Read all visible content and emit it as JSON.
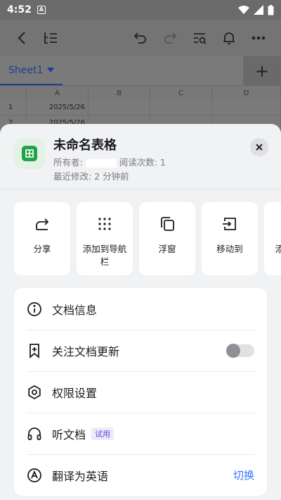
{
  "status_bar": {
    "time": "4:52",
    "app_badge": "A"
  },
  "toolbar": {
    "icons": [
      "back-icon",
      "outline-icon",
      "undo-icon",
      "redo-icon",
      "search-doc-icon",
      "bell-icon",
      "more-icon"
    ]
  },
  "sheet_tabs": {
    "active_tab": "Sheet1",
    "add_label": "+"
  },
  "grid": {
    "columns": [
      "A",
      "B",
      "C",
      "D"
    ],
    "rows": [
      {
        "num": "1",
        "a": "2025/5/26"
      },
      {
        "num": "2",
        "a": "2025/5/26"
      }
    ]
  },
  "doc": {
    "title": "未命名表格",
    "owner_label": "所有者:",
    "read_count_label": "阅读次数: 1",
    "last_modified": "最近修改: 2 分钟前"
  },
  "actions": [
    {
      "label": "分享",
      "icon": "share-icon"
    },
    {
      "label": "添加到导航栏",
      "icon": "grid-dots-icon"
    },
    {
      "label": "浮窗",
      "icon": "float-window-icon"
    },
    {
      "label": "移动到",
      "icon": "move-to-icon"
    },
    {
      "label": "添",
      "icon": "partial-icon"
    }
  ],
  "menu": [
    {
      "label": "文档信息",
      "icon": "info-icon"
    },
    {
      "label": "关注文档更新",
      "icon": "bookmark-plus-icon",
      "toggle_on": false
    },
    {
      "label": "权限设置",
      "icon": "gear-icon"
    },
    {
      "label": "听文档",
      "icon": "headphones-icon",
      "badge": "试用"
    },
    {
      "label": "翻译为英语",
      "icon": "translate-icon",
      "action": "切换"
    }
  ],
  "colors": {
    "accent": "#3370ff",
    "sheet_icon": "#1fa548",
    "badge_text": "#5a4bd6"
  }
}
